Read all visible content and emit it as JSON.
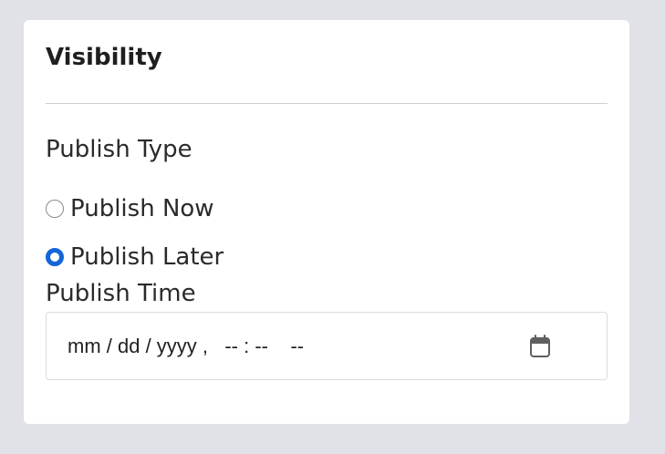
{
  "card": {
    "title": "Visibility"
  },
  "publish_type": {
    "label": "Publish Type",
    "options": [
      {
        "label": "Publish Now",
        "checked": false
      },
      {
        "label": "Publish Later",
        "checked": true
      }
    ]
  },
  "publish_time": {
    "label": "Publish Time",
    "display": "mm / dd / yyyy ,   -- : --    --",
    "calendar_icon": "calendar-icon"
  },
  "colors": {
    "background": "#e1e2e8",
    "card": "#ffffff",
    "accent": "#1565d8",
    "text": "#222222",
    "divider": "#cfcfcf"
  }
}
